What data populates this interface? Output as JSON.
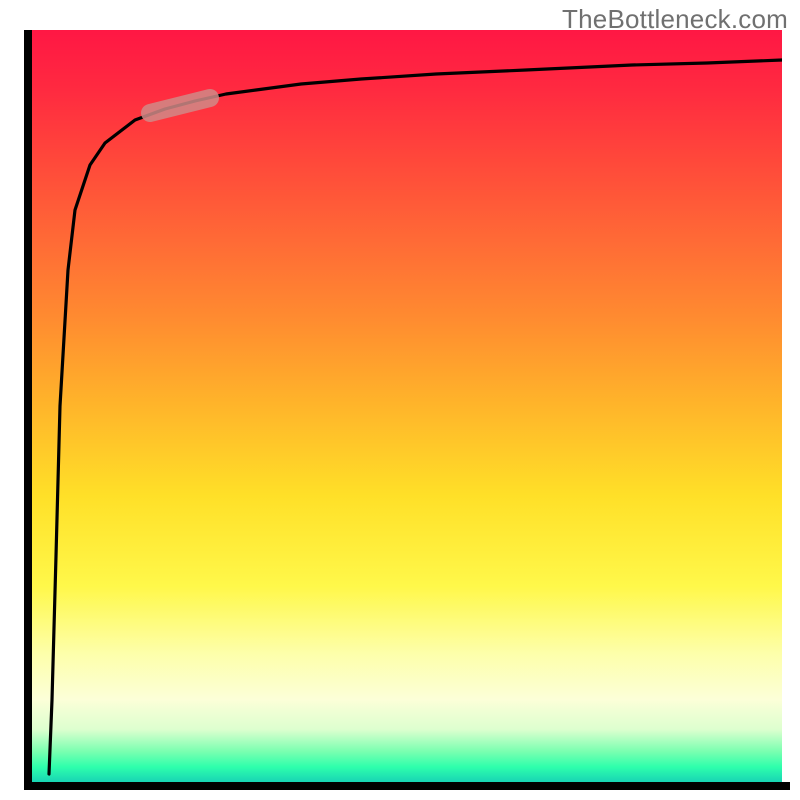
{
  "watermark": "TheBottleneck.com",
  "colors": {
    "gradient_top": "#ff1744",
    "gradient_mid1": "#ff8a30",
    "gradient_mid2": "#ffe028",
    "gradient_mid3": "#fdffab",
    "gradient_bottom": "#18d4b4",
    "curve": "#000000",
    "highlight": "#d08a87",
    "axis": "#000000",
    "watermark_text": "#707070"
  },
  "chart_data": {
    "type": "line",
    "title": "",
    "xlabel": "",
    "ylabel": "",
    "xlim": [
      0,
      100
    ],
    "ylim": [
      0,
      100
    ],
    "series": [
      {
        "name": "curve",
        "x": [
          2.5,
          3,
          3.5,
          4,
          5,
          6,
          8,
          10,
          14,
          18,
          22,
          26,
          30,
          36,
          44,
          54,
          66,
          80,
          90,
          100
        ],
        "y": [
          1,
          10,
          30,
          50,
          68,
          76,
          82,
          85,
          88,
          89.5,
          90.5,
          91.5,
          92,
          92.8,
          93.5,
          94.2,
          94.8,
          95.3,
          95.6,
          96
        ]
      }
    ],
    "highlight_segment": {
      "x_start": 16,
      "x_end": 24,
      "y_start": 89,
      "y_end": 91,
      "description": "short pale capsule overlay on curve"
    },
    "axes_visible": {
      "left": true,
      "bottom": true,
      "ticks": false,
      "labels": false
    },
    "background_gradient": "vertical red→orange→yellow→pale→green"
  }
}
